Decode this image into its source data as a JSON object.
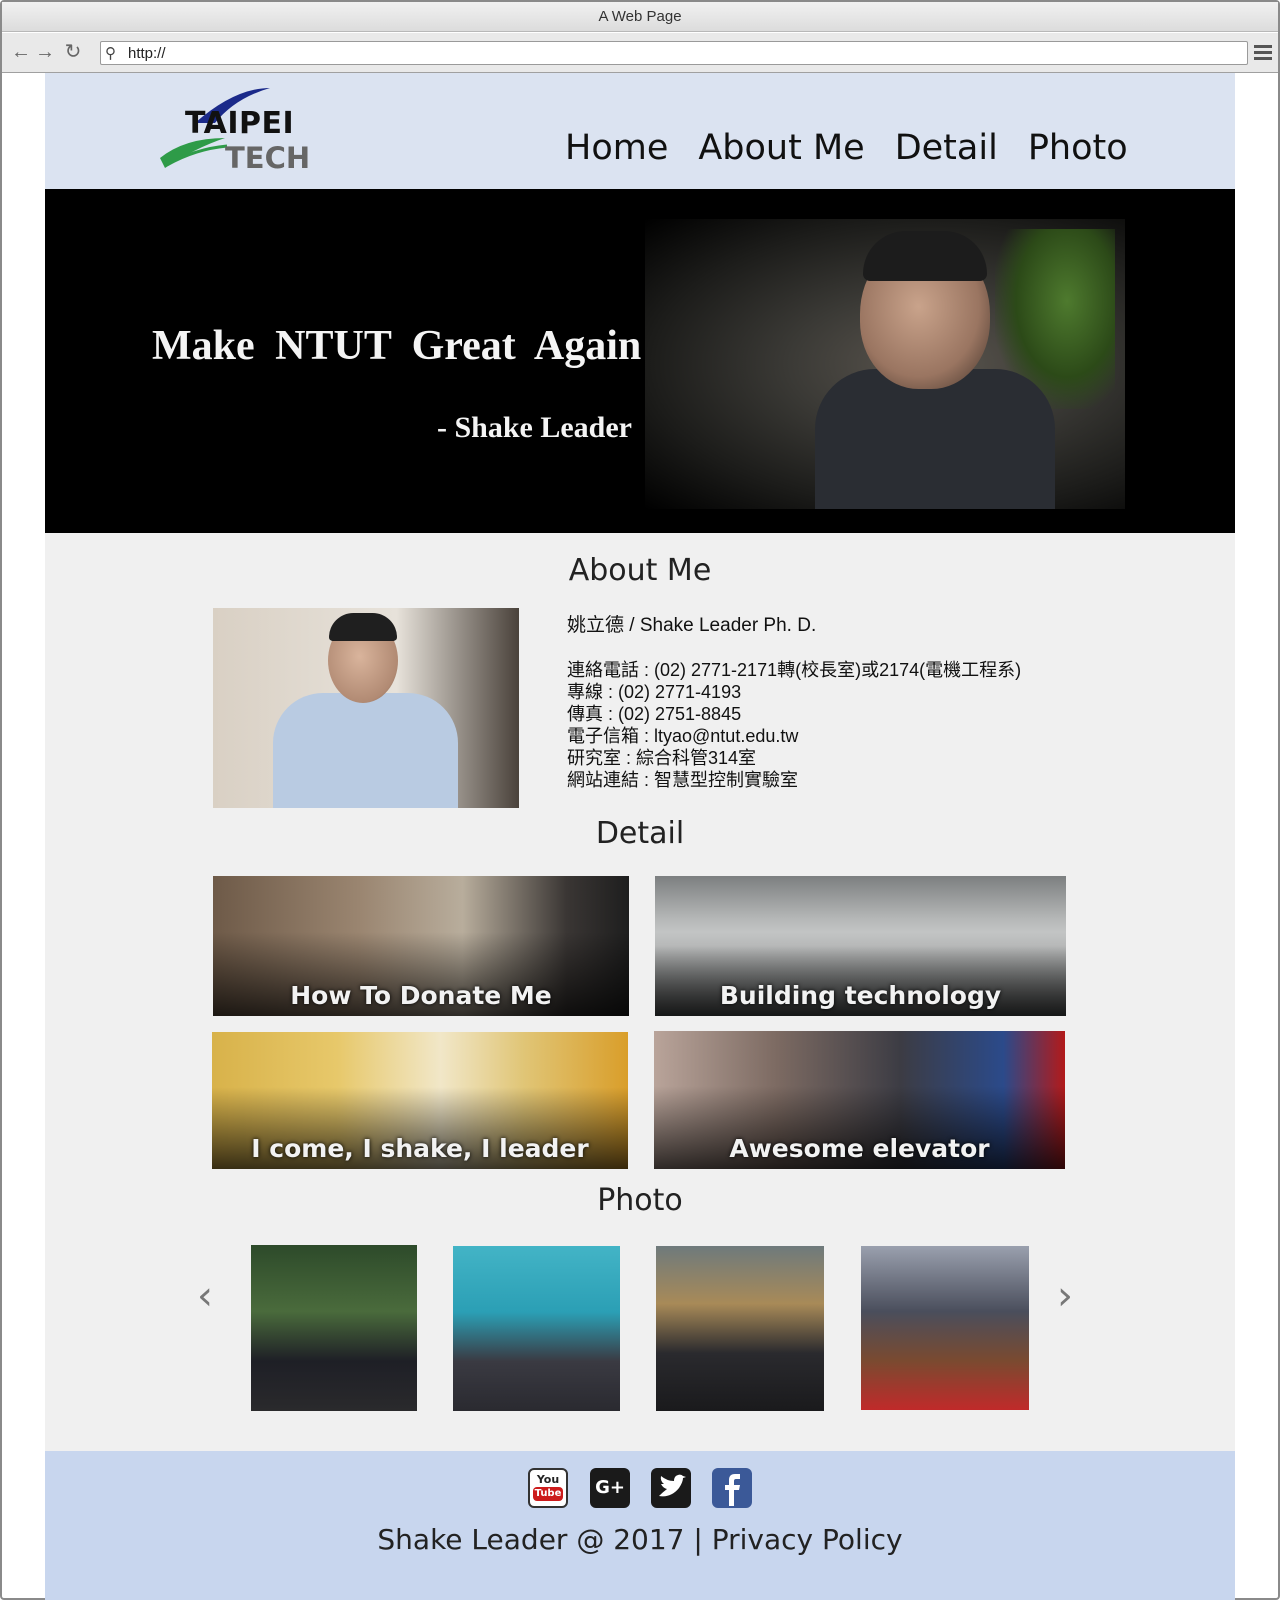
{
  "browser": {
    "window_title": "A Web Page",
    "url": "http://"
  },
  "header": {
    "logo_line1": "TAIPEI",
    "logo_line2": "TECH",
    "nav": [
      "Home",
      "About Me",
      "Detail",
      "Photo"
    ]
  },
  "hero": {
    "headline": "Make  NTUT  Great  Again",
    "subline": "- Shake Leader"
  },
  "about": {
    "title": "About  Me",
    "name": "姚立德 / Shake Leader Ph. D.",
    "lines": [
      "連絡電話 : (02) 2771-2171轉(校長室)或2174(電機工程系)",
      "專線 : (02) 2771-4193",
      "傳真 : (02) 2751-8845",
      "電子信箱 : ltyao@ntut.edu.tw",
      "研究室 : 綜合科管314室",
      "網站連結 : 智慧型控制實驗室"
    ]
  },
  "detail": {
    "title": "Detail",
    "cards": [
      "How To Donate Me",
      "Building technology",
      "I come, I shake, I leader",
      "Awesome elevator"
    ]
  },
  "photo": {
    "title": "Photo",
    "prev_icon": "chevron-left-icon",
    "next_icon": "chevron-right-icon"
  },
  "footer": {
    "social": [
      "youtube-icon",
      "google-plus-icon",
      "twitter-icon",
      "facebook-icon"
    ],
    "youtube_top": "You",
    "youtube_bottom": "Tube",
    "copyright": "Shake Leader @ 2017",
    "separator": "|",
    "privacy": "Privacy Policy"
  },
  "colors": {
    "header_bg": "#dbe3f1",
    "footer_bg": "#c8d6ee",
    "page_bg": "#f0f0f0",
    "hero_bg": "#000000"
  }
}
